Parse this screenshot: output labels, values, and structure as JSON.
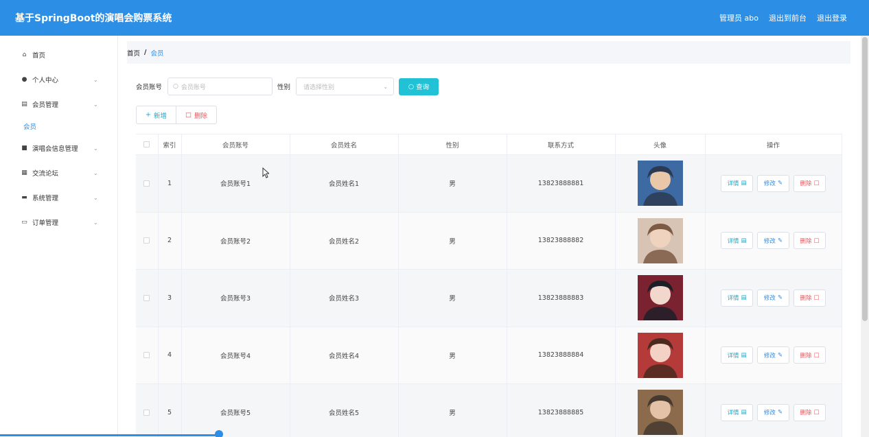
{
  "header": {
    "title": "基于SpringBoot的演唱会购票系统",
    "admin_label": "管理员 abo",
    "front_label": "退出到前台",
    "logout_label": "退出登录"
  },
  "sidebar": {
    "items": [
      {
        "label": "首页",
        "icon": "home-icon",
        "expandable": false
      },
      {
        "label": "个人中心",
        "icon": "user-icon",
        "expandable": true
      },
      {
        "label": "会员管理",
        "icon": "bar-chart-icon",
        "expandable": true
      },
      {
        "label": "演唱会信息管理",
        "icon": "clipboard-icon",
        "expandable": true
      },
      {
        "label": "交流论坛",
        "icon": "grid-icon",
        "expandable": true
      },
      {
        "label": "系统管理",
        "icon": "briefcase-icon",
        "expandable": true
      },
      {
        "label": "订单管理",
        "icon": "chat-icon",
        "expandable": true
      }
    ],
    "subitem": "会员"
  },
  "breadcrumb": {
    "home": "首页",
    "separator": "/",
    "current": "会员"
  },
  "search": {
    "account_label": "会员账号",
    "account_placeholder": "会员账号",
    "gender_label": "性别",
    "gender_placeholder": "请选择性别",
    "query_label": "查询"
  },
  "actions": {
    "add_label": "新增",
    "delete_label": "删除"
  },
  "table": {
    "headers": [
      "索引",
      "会员账号",
      "会员姓名",
      "性别",
      "联系方式",
      "头像",
      "操作"
    ],
    "op_labels": {
      "detail": "详情",
      "edit": "修改",
      "delete": "删除"
    },
    "rows": [
      {
        "index": "1",
        "account": "会员账号1",
        "name": "会员姓名1",
        "gender": "男",
        "phone": "13823888881"
      },
      {
        "index": "2",
        "account": "会员账号2",
        "name": "会员姓名2",
        "gender": "男",
        "phone": "13823888882"
      },
      {
        "index": "3",
        "account": "会员账号3",
        "name": "会员姓名3",
        "gender": "男",
        "phone": "13823888883"
      },
      {
        "index": "4",
        "account": "会员账号4",
        "name": "会员姓名4",
        "gender": "男",
        "phone": "13823888884"
      },
      {
        "index": "5",
        "account": "会员账号5",
        "name": "会员姓名5",
        "gender": "男",
        "phone": "13823888885"
      }
    ]
  },
  "colors": {
    "primary": "#2d8ee6",
    "query_button": "#22c2d6",
    "danger": "#e2565b"
  }
}
